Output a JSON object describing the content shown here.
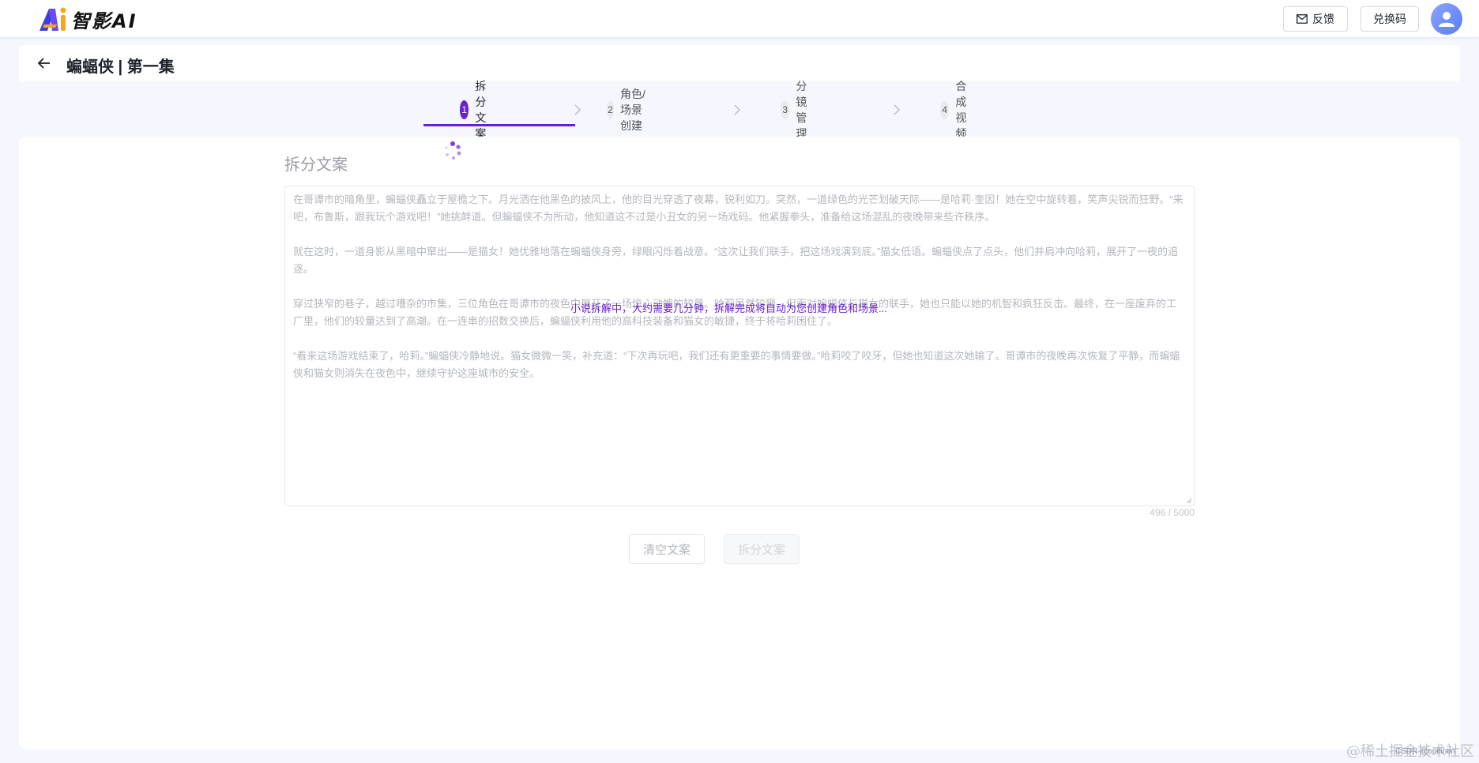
{
  "header": {
    "logo_text": "智影AI",
    "feedback_label": "反馈",
    "redeem_label": "兑换码"
  },
  "title_bar": {
    "title": "蝙蝠侠 | 第一集"
  },
  "steps": [
    {
      "num": "1",
      "label": "拆分文案",
      "active": true
    },
    {
      "num": "2",
      "label": "角色/场景创建",
      "active": false
    },
    {
      "num": "3",
      "label": "分镜管理",
      "active": false
    },
    {
      "num": "4",
      "label": "合成视频",
      "active": false
    }
  ],
  "main": {
    "section_title": "拆分文案",
    "paragraphs": [
      "在哥谭市的暗角里，蝙蝠侠矗立于屋檐之下。月光洒在他黑色的披风上，他的目光穿透了夜幕，锐利如刀。突然，一道绿色的光芒划破天际——是哈莉·奎因！她在空中旋转着，笑声尖锐而狂野。“来吧，布鲁斯，跟我玩个游戏吧！”她挑衅道。但蝙蝠侠不为所动，他知道这不过是小丑女的另一场戏码。他紧握拳头，准备给这场混乱的夜晚带来些许秩序。",
      "就在这时，一道身影从黑暗中窜出——是猫女！她优雅地落在蝙蝠侠身旁，绿眼闪烁着战意。“这次让我们联手，把这场戏演到底。”猫女低语。蝙蝠侠点了点头，他们并肩冲向哈莉，展开了一夜的追逐。",
      "穿过狭窄的巷子，越过嘈杂的市集，三位角色在哥谭市的夜色中展开了一场惊心动魄的较量。哈莉虽然狡猾，但面对蝙蝠侠与猫女的联手，她也只能以她的机智和疯狂反击。最终，在一座废弃的工厂里，他们的较量达到了高潮。在一连串的招数交换后，蝙蝠侠利用他的高科技装备和猫女的敏捷，终于将哈莉困住了。",
      "“看来这场游戏结束了，哈莉。”蝙蝠侠冷静地说。猫女微微一笑，补充道：“下次再玩吧，我们还有更重要的事情要做。”哈莉咬了咬牙，但她也知道这次她输了。哥谭市的夜晚再次恢复了平静，而蝙蝠侠和猫女则消失在夜色中，继续守护这座城市的安全。"
    ],
    "counter": "496 / 5000",
    "clear_label": "清空文案",
    "split_label": "拆分文案",
    "loading_text": "小说拆解中，大约需要几分钟，拆解完成将自动为您创建角色和场景..."
  },
  "watermark": {
    "text": "@稀土掘金技术社区",
    "small": "CSDN @onitintin"
  },
  "colors": {
    "accent": "#6a1fd1",
    "page_bg": "#f4f7fd"
  }
}
